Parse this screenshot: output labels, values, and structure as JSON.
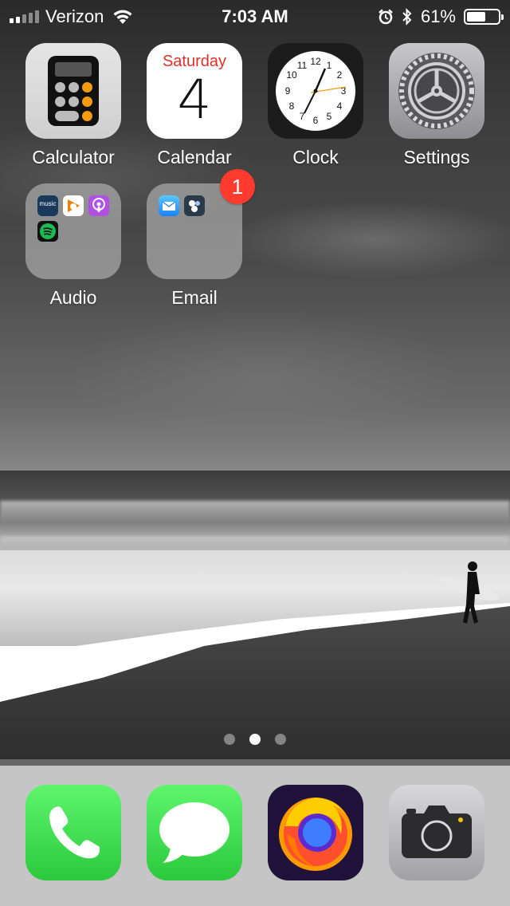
{
  "status_bar": {
    "carrier": "Verizon",
    "time": "7:03 AM",
    "battery_percent_label": "61%",
    "battery_level": 0.61,
    "signal_bars": 2,
    "signal_bars_total": 5
  },
  "apps": [
    {
      "label": "Calculator",
      "icon": "calculator-icon"
    },
    {
      "label": "Calendar",
      "icon": "calendar-icon",
      "day": "Saturday",
      "date": "4"
    },
    {
      "label": "Clock",
      "icon": "clock-icon"
    },
    {
      "label": "Settings",
      "icon": "settings-icon"
    }
  ],
  "folders": [
    {
      "label": "Audio",
      "contents": [
        "amazon-music-icon",
        "google-play-music-icon",
        "podcasts-icon",
        "spotify-icon"
      ],
      "mini_texts": {
        "amazon": "music"
      }
    },
    {
      "label": "Email",
      "contents": [
        "mail-icon",
        "unknown-app-icon"
      ],
      "badge": "1"
    }
  ],
  "page_indicator": {
    "pages": 3,
    "current": 2
  },
  "dock": [
    {
      "name": "Phone",
      "icon": "phone-icon"
    },
    {
      "name": "Messages",
      "icon": "messages-icon"
    },
    {
      "name": "Firefox",
      "icon": "firefox-icon"
    },
    {
      "name": "Camera",
      "icon": "camera-icon"
    }
  ],
  "colors": {
    "badge": "#ff3b30",
    "calendar_day": "#e0302b",
    "calculator_operator": "#f39c12",
    "dock_green": "#2bc93c"
  }
}
